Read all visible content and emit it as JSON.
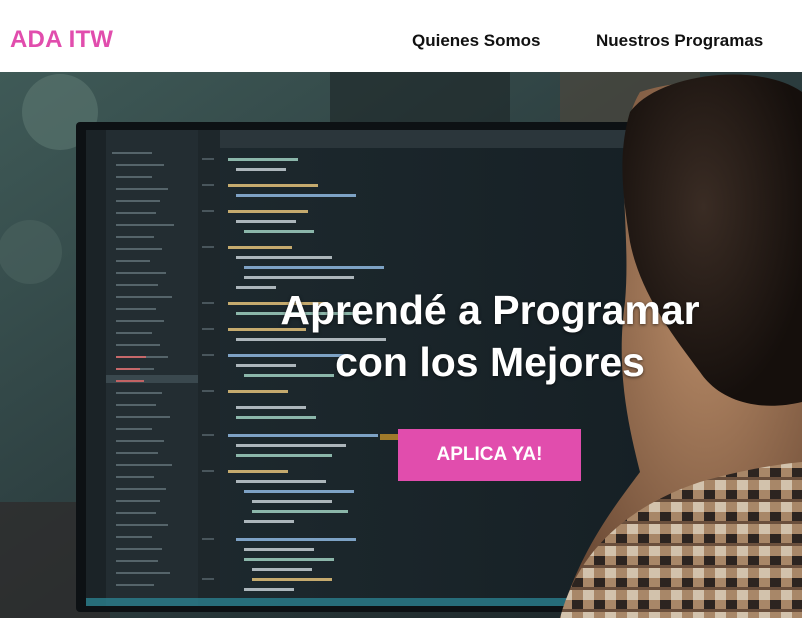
{
  "header": {
    "brand": "ADA ITW",
    "nav": [
      {
        "label": "Quienes Somos"
      },
      {
        "label": "Nuestros Programas"
      }
    ]
  },
  "hero": {
    "title_line1": "Aprendé a Programar",
    "title_line2": "con los Mejores",
    "cta_label": "APLICA YA!"
  },
  "colors": {
    "brand": "#e14dad",
    "nav_text": "#111111",
    "hero_text": "#ffffff"
  }
}
